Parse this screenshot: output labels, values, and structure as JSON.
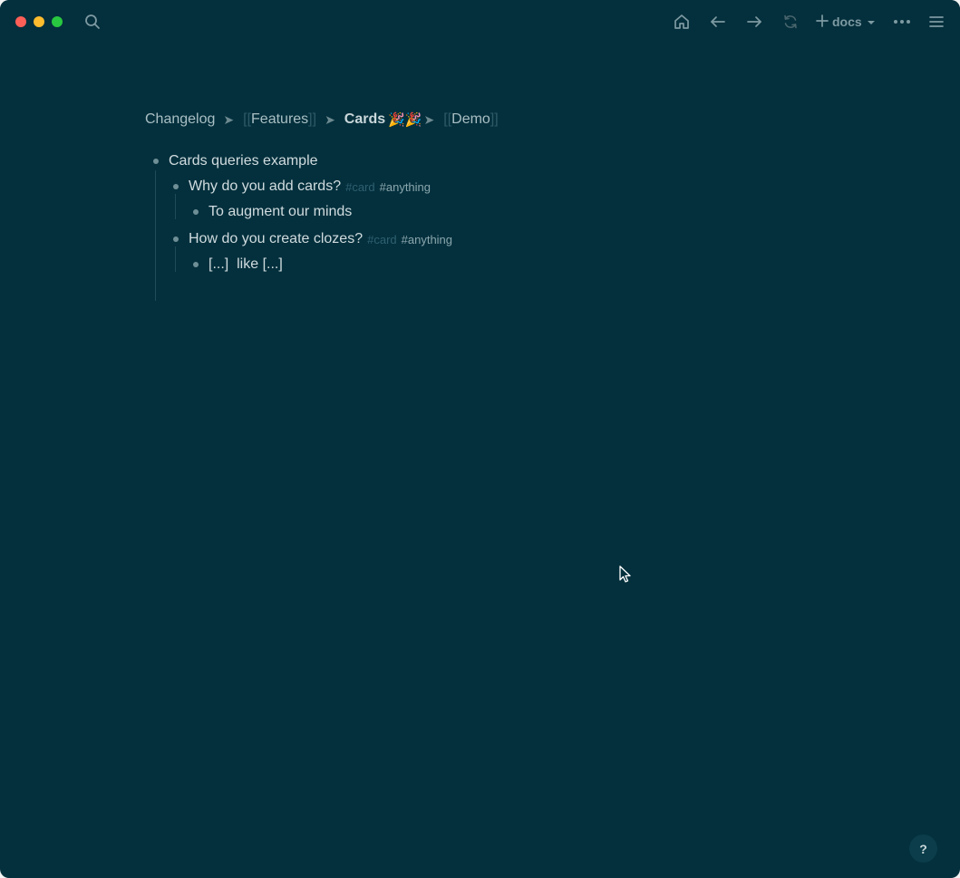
{
  "toolbar": {
    "new_page_label": "docs",
    "icons": [
      "search-icon",
      "home-icon",
      "back-arrow-icon",
      "forward-arrow-icon",
      "sync-icon",
      "plus-icon",
      "more-icon",
      "menu-icon"
    ]
  },
  "breadcrumb": {
    "items": [
      {
        "label": "Changelog",
        "bracketed": false
      },
      {
        "label": "Features",
        "bracketed": true
      },
      {
        "label": "Cards",
        "bracketed": false,
        "bold": true,
        "emoji": "🎉🎉"
      },
      {
        "label": "Demo",
        "bracketed": true
      }
    ],
    "open_bracket": "[[",
    "close_bracket": "]]",
    "separator": "➤"
  },
  "blocks": {
    "root": {
      "text": "Cards queries example"
    },
    "q1": {
      "text": "Why do you add cards?",
      "tag_card": "#card",
      "tag_anything": "#anything"
    },
    "a1": {
      "text": "To augment our minds"
    },
    "q2": {
      "text": "How do you create clozes?",
      "tag_card": "#card",
      "tag_anything": "#anything"
    },
    "a2": {
      "text": "[...]  like [...]"
    }
  },
  "help": {
    "label": "?"
  },
  "colors": {
    "background": "#04303d",
    "text": "#d0dcdf",
    "muted": "#7d9aa2",
    "bracket": "#2e5967",
    "tag_dim": "#2f6070"
  }
}
